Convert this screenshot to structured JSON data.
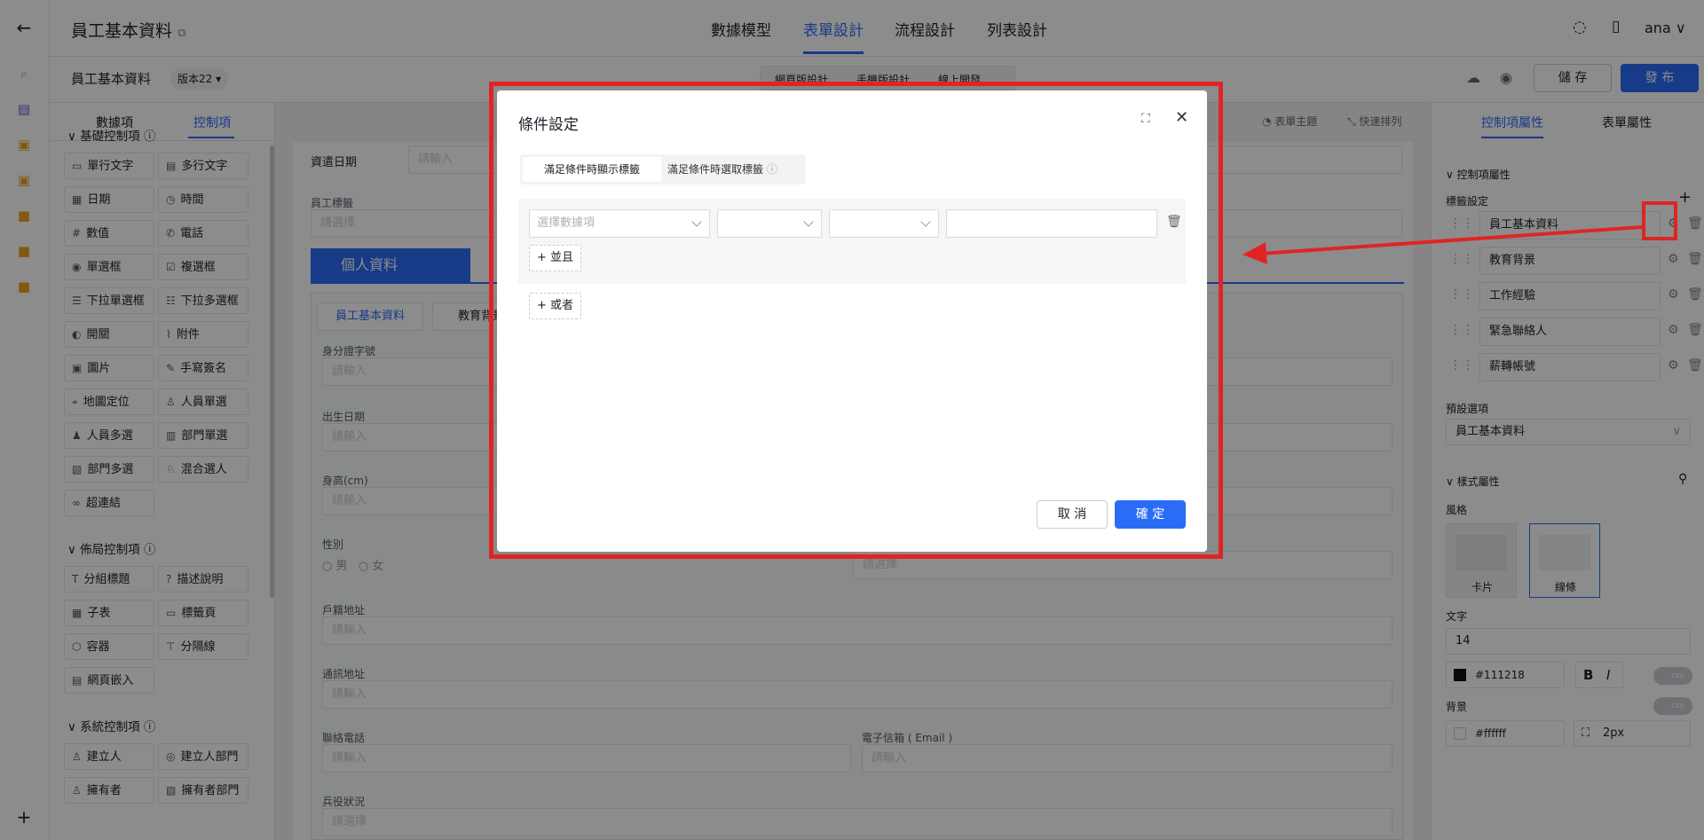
{
  "app": {
    "title": "員工基本資料",
    "user": "ana"
  },
  "nav_tabs": [
    {
      "label": "數據模型"
    },
    {
      "label": "表單設計"
    },
    {
      "label": "流程設計"
    },
    {
      "label": "列表設計"
    }
  ],
  "subbar": {
    "form_name": "員工基本資料",
    "version": "版本22",
    "mode_tabs": [
      "網頁版設計",
      "手機版設計",
      "線上開發"
    ],
    "save": "儲 存",
    "publish": "發 布"
  },
  "left_panel": {
    "tabs": [
      "數據項",
      "控制項"
    ],
    "sections": [
      {
        "title": "基礎控制項",
        "items": [
          {
            "label": "單行文字",
            "icon": "single-line-icon"
          },
          {
            "label": "多行文字",
            "icon": "multi-line-icon"
          },
          {
            "label": "日期",
            "icon": "calendar-icon"
          },
          {
            "label": "時間",
            "icon": "clock-icon"
          },
          {
            "label": "數值",
            "icon": "number-icon"
          },
          {
            "label": "電話",
            "icon": "phone-icon"
          },
          {
            "label": "單選框",
            "icon": "radio-icon"
          },
          {
            "label": "複選框",
            "icon": "checkbox-icon"
          },
          {
            "label": "下拉單選框",
            "icon": "dropdown-single-icon"
          },
          {
            "label": "下拉多選框",
            "icon": "dropdown-multi-icon"
          },
          {
            "label": "開關",
            "icon": "switch-icon"
          },
          {
            "label": "附件",
            "icon": "paperclip-icon"
          },
          {
            "label": "圖片",
            "icon": "image-icon"
          },
          {
            "label": "手寫簽名",
            "icon": "pen-icon"
          },
          {
            "label": "地圖定位",
            "icon": "location-icon"
          },
          {
            "label": "人員單選",
            "icon": "person-icon"
          },
          {
            "label": "人員多選",
            "icon": "people-icon"
          },
          {
            "label": "部門單選",
            "icon": "department-icon"
          },
          {
            "label": "部門多選",
            "icon": "departments-icon"
          },
          {
            "label": "混合選人",
            "icon": "mixed-person-icon"
          },
          {
            "label": "超連結",
            "icon": "link-icon"
          }
        ]
      },
      {
        "title": "佈局控制項",
        "items": [
          {
            "label": "分組標題",
            "icon": "heading-icon"
          },
          {
            "label": "描述說明",
            "icon": "help-icon"
          },
          {
            "label": "子表",
            "icon": "table-icon"
          },
          {
            "label": "標籤頁",
            "icon": "tab-icon"
          },
          {
            "label": "容器",
            "icon": "container-icon"
          },
          {
            "label": "分隔線",
            "icon": "divider-icon"
          },
          {
            "label": "網頁嵌入",
            "icon": "embed-icon"
          }
        ]
      },
      {
        "title": "系統控制項",
        "items": [
          {
            "label": "建立人",
            "icon": "person-icon"
          },
          {
            "label": "建立人部門",
            "icon": "org-icon"
          },
          {
            "label": "擁有者",
            "icon": "owner-icon"
          },
          {
            "label": "擁有者部門",
            "icon": "owner-dept-icon"
          }
        ]
      }
    ]
  },
  "canvas": {
    "toolbar": [
      "表單主題",
      "快速排列"
    ],
    "date_label": "資遣日期",
    "date_placeholder": "請輸入",
    "tag_label": "員工標籤",
    "select_placeholder": "請選擇",
    "banner": "個人資料",
    "tabs": [
      "員工基本資料",
      "教育背景"
    ],
    "fields": {
      "id": "身分證字號",
      "birth": "出生日期",
      "height": "身高(cm)",
      "gender": "性別",
      "male": "男",
      "female": "女",
      "household": "戶籍地址",
      "mail_address": "通訊地址",
      "phone": "聯絡電話",
      "email": "電子信箱 ( Email )",
      "military": "兵役狀況"
    },
    "input_placeholder": "請輸入"
  },
  "right_panel": {
    "tabs": [
      "控制項屬性",
      "表單屬性"
    ],
    "section_title": "控制項屬性",
    "tag_setting_label": "標籤設定",
    "tags": [
      "員工基本資料",
      "教育背景",
      "工作經驗",
      "緊急聯絡人",
      "薪轉帳號"
    ],
    "default_label": "預設選項",
    "default_value": "員工基本資料",
    "style_section": "樣式屬性",
    "style_label": "風格",
    "style_options": [
      "卡片",
      "線條"
    ],
    "text_label": "文字",
    "font_size": "14",
    "text_color": "#111218",
    "bold": "B",
    "italic": "I",
    "css_toggle": "css",
    "bg_label": "背景",
    "bg_color": "#ffffff",
    "radius": "2px"
  },
  "dialog": {
    "title": "條件設定",
    "tabs": [
      "滿足條件時顯示標籤",
      "滿足條件時選取標籤"
    ],
    "field_placeholder": "選擇數據項",
    "and_button": "並且",
    "or_button": "或者",
    "cancel": "取 消",
    "confirm": "確 定"
  },
  "colors": {
    "accent": "#2b6cf6",
    "highlight": "#e02424"
  }
}
